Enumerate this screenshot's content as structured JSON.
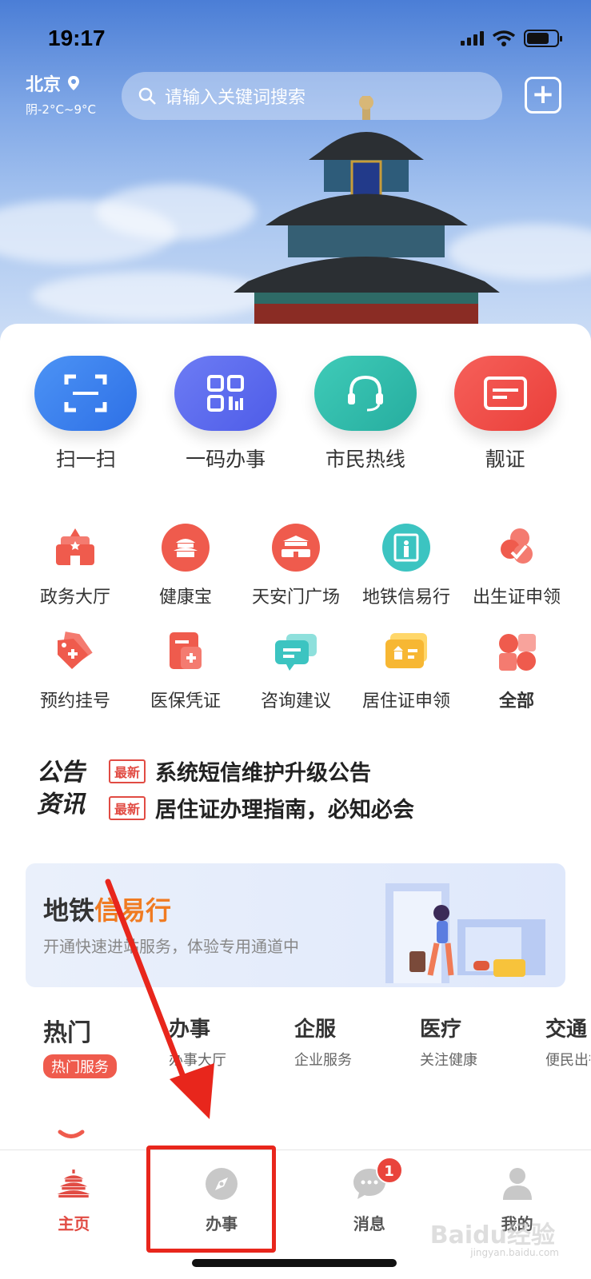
{
  "status_bar": {
    "time": "19:17"
  },
  "header": {
    "city": "北京",
    "weather": "阴-2°C~9°C",
    "search_placeholder": "请输入关键词搜索"
  },
  "quick_actions": [
    {
      "label": "扫一扫",
      "icon": "scan-icon",
      "color": "#3f86f2"
    },
    {
      "label": "一码办事",
      "icon": "qr-code-icon",
      "color": "#5f6ef0"
    },
    {
      "label": "市民热线",
      "icon": "headset-icon",
      "color": "#33bfae"
    },
    {
      "label": "靓证",
      "icon": "card-icon",
      "color": "#f2514a"
    }
  ],
  "services": [
    {
      "label": "政务大厅",
      "icon": "government-hall-icon"
    },
    {
      "label": "健康宝",
      "icon": "health-code-icon"
    },
    {
      "label": "天安门广场",
      "icon": "tiananmen-icon"
    },
    {
      "label": "地铁信易行",
      "icon": "subway-gate-icon"
    },
    {
      "label": "出生证申领",
      "icon": "birth-certificate-icon"
    },
    {
      "label": "预约挂号",
      "icon": "appointment-icon"
    },
    {
      "label": "医保凭证",
      "icon": "medical-insurance-icon"
    },
    {
      "label": "咨询建议",
      "icon": "consult-icon"
    },
    {
      "label": "居住证申领",
      "icon": "residence-permit-icon"
    },
    {
      "label": "全部",
      "icon": "all-services-icon"
    }
  ],
  "notices": {
    "logo_line1": "公告",
    "logo_line2": "资讯",
    "items": [
      {
        "tag": "最新",
        "text": "系统短信维护升级公告"
      },
      {
        "tag": "最新",
        "text": "居住证办理指南，必知必会"
      }
    ]
  },
  "banner": {
    "title_plain": "地铁",
    "title_accent": "信易行",
    "subtitle": "开通快速进站服务，体验专用通道中"
  },
  "tabs": [
    {
      "main": "热门",
      "sub": "热门服务"
    },
    {
      "main": "办事",
      "sub": "办事大厅"
    },
    {
      "main": "企服",
      "sub": "企业服务"
    },
    {
      "main": "医疗",
      "sub": "关注健康"
    },
    {
      "main": "交通",
      "sub": "便民出行"
    }
  ],
  "bottom_nav": [
    {
      "label": "主页",
      "icon": "temple-home-icon"
    },
    {
      "label": "办事",
      "icon": "compass-icon"
    },
    {
      "label": "消息",
      "icon": "chat-icon",
      "badge": "1"
    },
    {
      "label": "我的",
      "icon": "user-icon"
    }
  ],
  "watermark": {
    "text": "Baidu经验",
    "sub": "jingyan.baidu.com"
  },
  "colors": {
    "brand_red": "#e14b43",
    "highlight": "#e8261c"
  }
}
